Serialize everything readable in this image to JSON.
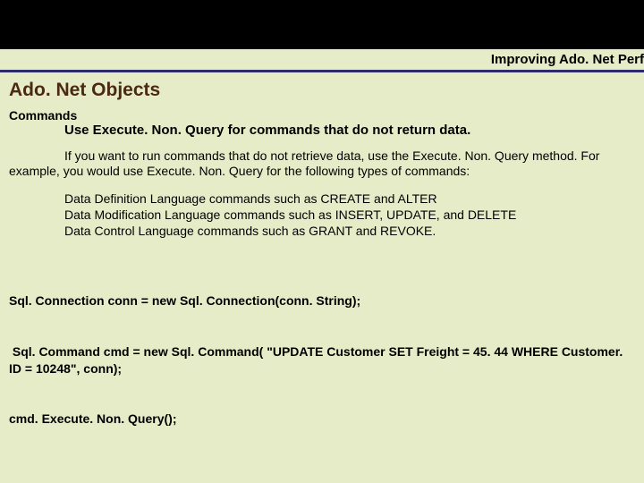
{
  "header": {
    "breadcrumb": "Improving Ado. Net Perf"
  },
  "title": "Ado. Net Objects",
  "section": {
    "heading": "Commands",
    "subheading": "Use Execute. Non. Query for commands that do not return data."
  },
  "paragraph": "If you want to run commands that do not retrieve data, use the Execute. Non. Query method. For example, you would use Execute. Non. Query for the following types of commands:",
  "bullets": {
    "item1": "Data Definition Language commands such as CREATE and ALTER",
    "item2": "Data Modification Language commands such as INSERT, UPDATE, and DELETE",
    "item3": "Data Control Language commands such as GRANT and REVOKE."
  },
  "code": {
    "line1": "Sql. Connection conn = new Sql. Connection(conn. String);",
    "line2": " Sql. Command cmd = new Sql. Command( \"UPDATE Customer SET Freight = 45. 44 WHERE Customer. ID = 10248\", conn);",
    "line3": "cmd. Execute. Non. Query();"
  }
}
